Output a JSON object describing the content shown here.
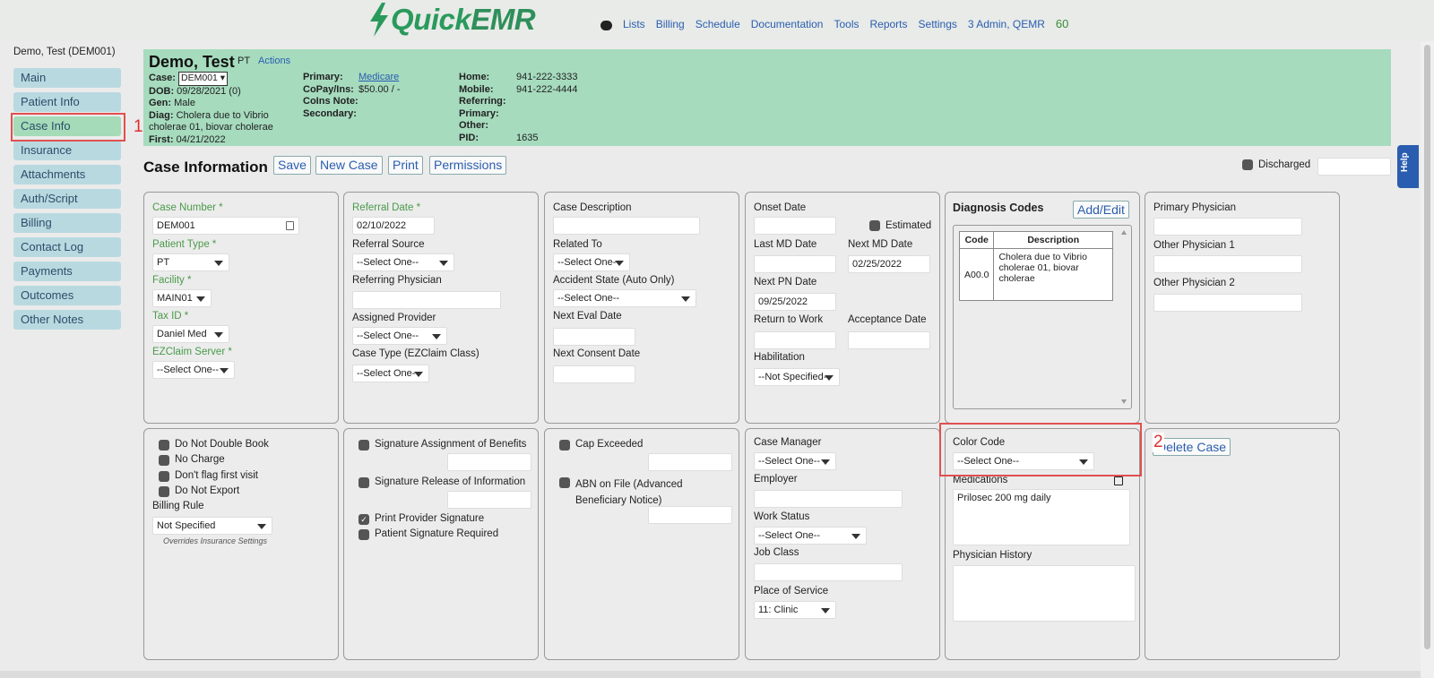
{
  "app": {
    "logo_text": "QuickEMR",
    "logo_prefix": "Quick",
    "logo_suffix": "EMR",
    "chat_icon": "chat-bubble-icon",
    "brand_color": "#2a9a5c"
  },
  "nav": {
    "items": [
      "Lists",
      "Billing",
      "Schedule",
      "Documentation",
      "Tools",
      "Reports",
      "Settings",
      "3 Admin, QEMR"
    ],
    "counter": "60"
  },
  "sidebar": {
    "patient": "Demo, Test (DEM001)",
    "items": [
      "Main",
      "Patient Info",
      "Case Info",
      "Insurance",
      "Attachments",
      "Auth/Script",
      "Billing",
      "Contact Log",
      "Payments",
      "Outcomes",
      "Other Notes"
    ],
    "active": "Case Info"
  },
  "annotations": {
    "one": "1",
    "two": "2"
  },
  "header": {
    "name": "Demo, Test",
    "type": "PT",
    "actions": "Actions",
    "case_label": "Case:",
    "case_value": "DEM001",
    "dob_label": "DOB:",
    "dob": "09/28/2021 (0)",
    "gen_label": "Gen:",
    "gen": "Male",
    "diag_label": "Diag:",
    "diag": "Cholera due to Vibrio cholerae 01, biovar cholerae",
    "first_label": "First:",
    "first": "04/21/2022",
    "primary_label": "Primary:",
    "primary": "Medicare",
    "copay_label": "CoPay/Ins:",
    "copay": "$50.00 / -",
    "coins_label": "CoIns Note:",
    "secondary_label": "Secondary:",
    "home_label": "Home:",
    "home": "941-222-3333",
    "mobile_label": "Mobile:",
    "mobile": "941-222-4444",
    "referring_label": "Referring:",
    "primary2_label": "Primary:",
    "other_label": "Other:",
    "pid_label": "PID:",
    "pid": "1635"
  },
  "toolbar": {
    "title": "Case Information",
    "save": "Save",
    "new_case": "New Case",
    "print": "Print",
    "permissions": "Permissions",
    "discharged": "Discharged",
    "help": "Help"
  },
  "p1": {
    "case_number_label": "Case Number *",
    "case_number": "DEM001",
    "patient_type_label": "Patient Type *",
    "patient_type": "PT",
    "facility_label": "Facility *",
    "facility": "MAIN01",
    "tax_id_label": "Tax ID *",
    "tax_id": "Daniel Med",
    "ezclaim_label": "EZClaim Server *",
    "ezclaim": "--Select One--"
  },
  "p2": {
    "referral_date_label": "Referral Date *",
    "referral_date": "02/10/2022",
    "referral_source_label": "Referral Source",
    "referral_source": "--Select One--",
    "referring_physician_label": "Referring Physician",
    "assigned_provider_label": "Assigned Provider",
    "assigned_provider": "--Select One--",
    "case_type_label": "Case Type (EZClaim Class)",
    "case_type": "--Select One--"
  },
  "p3": {
    "case_desc_label": "Case Description",
    "related_to_label": "Related To",
    "related_to": "--Select One--",
    "accident_state_label": "Accident State (Auto Only)",
    "accident_state": "--Select One--",
    "next_eval_label": "Next Eval Date",
    "next_consent_label": "Next Consent Date"
  },
  "p4": {
    "onset_label": "Onset Date",
    "estimated": "Estimated",
    "last_md_label": "Last MD Date",
    "next_md_label": "Next MD Date",
    "next_md": "02/25/2022",
    "next_pn_label": "Next PN Date",
    "next_pn": "09/25/2022",
    "return_work_label": "Return to Work",
    "acceptance_label": "Acceptance Date",
    "habilitation_label": "Habilitation",
    "habilitation": "--Not Specified--"
  },
  "p5": {
    "title": "Diagnosis Codes",
    "add_edit": "Add/Edit",
    "col_code": "Code",
    "col_desc": "Description",
    "rows": [
      {
        "code": "A00.0",
        "desc": "Cholera due to Vibrio cholerae 01, biovar cholerae"
      }
    ]
  },
  "p6": {
    "primary_phys_label": "Primary Physician",
    "other_phys1_label": "Other Physician 1",
    "other_phys2_label": "Other Physician 2"
  },
  "p7": {
    "items": [
      "Do Not Double Book",
      "No Charge",
      "Don't flag first visit",
      "Do Not Export"
    ],
    "billing_rule_label": "Billing Rule",
    "billing_rule": "Not Specified",
    "note": "Overrides Insurance Settings"
  },
  "p8": {
    "sig_assign": "Signature Assignment of Benefits",
    "sig_release": "Signature Release of Information",
    "print_provider": "Print Provider Signature",
    "patient_sig": "Patient Signature Required"
  },
  "p9": {
    "cap_exceeded": "Cap Exceeded",
    "abn": "ABN on File (Advanced Beneficiary Notice)"
  },
  "p10": {
    "case_manager_label": "Case Manager",
    "case_manager": "--Select One--",
    "employer_label": "Employer",
    "work_status_label": "Work Status",
    "work_status": "--Select One--",
    "job_class_label": "Job Class",
    "pos_label": "Place of Service",
    "pos": "11: Clinic"
  },
  "p11": {
    "color_code_label": "Color Code",
    "color_code": "--Select One--",
    "medications_label": "Medications",
    "medications": "Prilosec 200 mg daily",
    "physician_history_label": "Physician History"
  },
  "p12": {
    "delete_case": "Delete Case"
  }
}
